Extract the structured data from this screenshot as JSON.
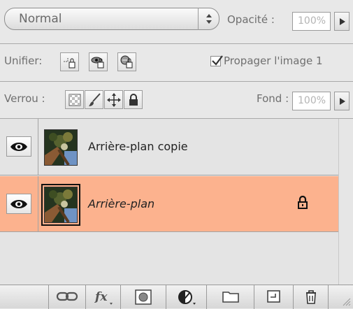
{
  "blend": {
    "mode": "Normal",
    "opacity_label": "Opacité :",
    "opacity_value": "100%"
  },
  "unify": {
    "label": "Unifier:",
    "propagate_label": "Propager l'image 1",
    "propagate_checked": true
  },
  "lock": {
    "label": "Verrou :",
    "fill_label": "Fond :",
    "fill_value": "100%"
  },
  "layers": [
    {
      "name": "Arrière-plan copie",
      "visible": true,
      "selected": false,
      "locked": false
    },
    {
      "name": "Arrière-plan",
      "visible": true,
      "selected": true,
      "locked": true
    }
  ],
  "colors": {
    "selected_layer": "#fcb28e",
    "panel_bg": "#e8e8e8"
  },
  "toolbar_icons": [
    "link-layers-icon",
    "layer-style-fx-icon",
    "layer-mask-icon",
    "adjustment-layer-icon",
    "new-group-icon",
    "new-layer-icon",
    "delete-layer-icon"
  ]
}
